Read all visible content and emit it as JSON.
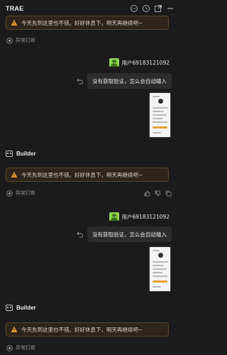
{
  "app": {
    "title": "TRAE"
  },
  "titlebar_icons": [
    "chat-icon",
    "history-icon",
    "open-external-icon",
    "minimize-icon"
  ],
  "warning": {
    "text": "今天先到这里也不错。好好休息下，明天再继续吧~"
  },
  "interrupt": {
    "text": "异常打断"
  },
  "messages": [
    {
      "user": "用户69183121092",
      "text": "没有获取验证，怎么会自动输入"
    },
    {
      "user": "用户69183121092",
      "text": "没有获取验证，怎么会自动输入"
    }
  ],
  "builder": {
    "label": "Builder"
  },
  "colors": {
    "background": "#1b1b1d",
    "warning_bg": "#2d251a",
    "warning_border": "#5c4526",
    "warning_icon": "#e39a34",
    "avatar": "#8fd14f"
  }
}
